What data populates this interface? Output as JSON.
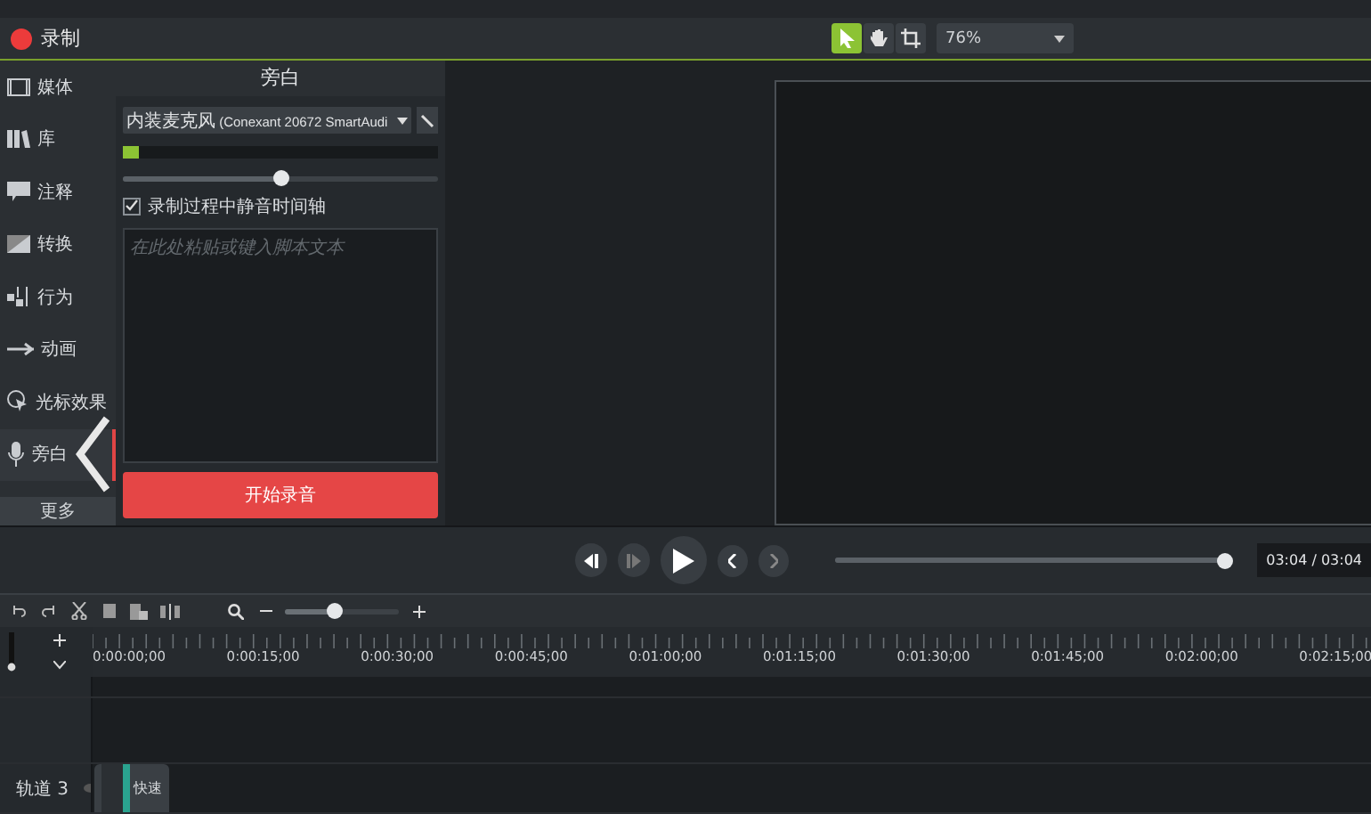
{
  "header": {
    "record_label": "录制",
    "tools": [
      {
        "kind": "select",
        "selected": true
      },
      {
        "kind": "pan",
        "selected": false
      },
      {
        "kind": "crop",
        "selected": false
      }
    ],
    "zoom": "76%"
  },
  "sidebar": {
    "items": [
      {
        "kind": "media",
        "label": "媒体",
        "selected": false
      },
      {
        "kind": "library",
        "label": "库",
        "selected": false
      },
      {
        "kind": "annotation",
        "label": "注释",
        "selected": false
      },
      {
        "kind": "transition",
        "label": "转换",
        "selected": false
      },
      {
        "kind": "behavior",
        "label": "行为",
        "selected": false
      },
      {
        "kind": "animation",
        "label": "动画",
        "selected": false
      },
      {
        "kind": "cursor",
        "label": "光标效果",
        "selected": false
      },
      {
        "kind": "voice",
        "label": "旁白",
        "selected": true
      }
    ],
    "more": "更多"
  },
  "panel": {
    "title": "旁白",
    "device": "内装麦克风 (Conexant 20672 SmartAudi",
    "input": {
      "level": 0.05
    },
    "volume": {
      "level": 0.5
    },
    "mute_option": {
      "label": "录制过程中静音时间轴",
      "checked": true
    },
    "script_placeholder": "在此处粘贴或键入脚本文本",
    "start_button": "开始录音"
  },
  "player": {
    "progress": {
      "level": 1
    },
    "time": "03:04 / 03:04"
  },
  "timeline": {
    "zoom": {
      "level": 0.43
    },
    "ruler": [
      "0:00:00;00",
      "0:00:15;00",
      "0:00:30;00",
      "0:00:45;00",
      "0:01:00;00",
      "0:01:15;00",
      "0:01:30;00",
      "0:01:45;00",
      "0:02:00;00",
      "0:02:15;00"
    ],
    "tracks": [
      {
        "label": "轨道 3",
        "clips": [
          {
            "label": "快速"
          }
        ]
      }
    ]
  }
}
